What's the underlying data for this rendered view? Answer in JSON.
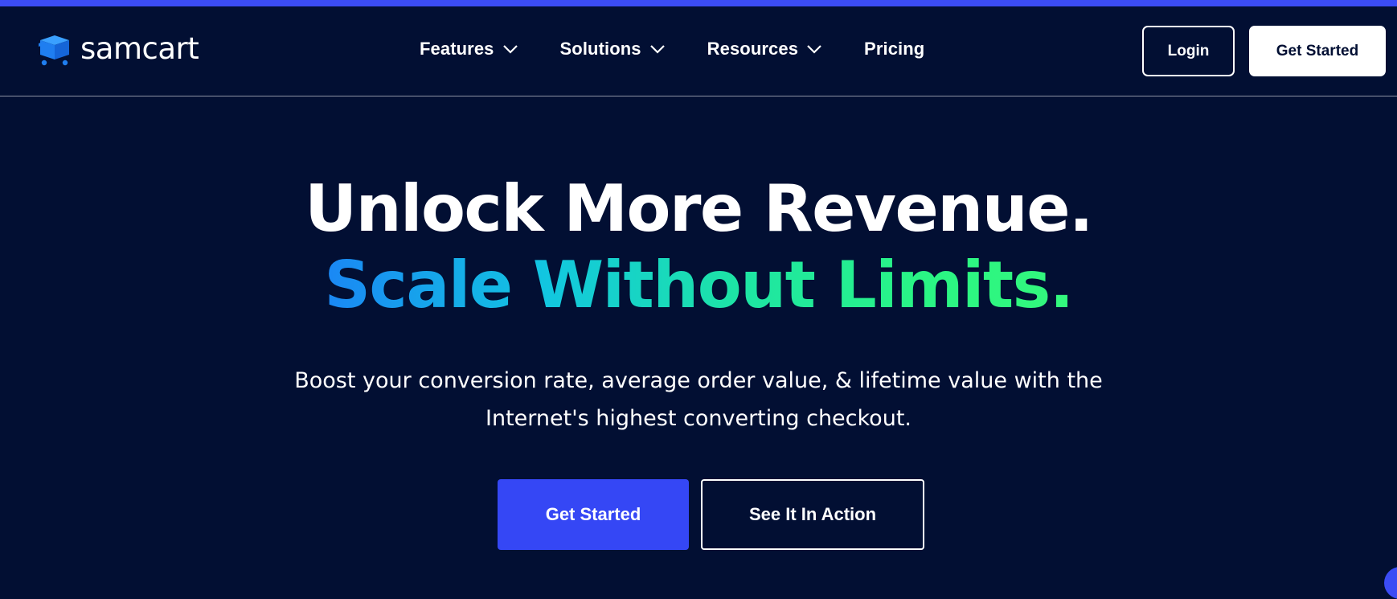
{
  "brand": {
    "name": "samcart",
    "logo_icon": "cart-box-icon",
    "accent_color": "#3547f5",
    "background_color": "#020f33"
  },
  "nav": {
    "items": [
      {
        "label": "Features",
        "has_dropdown": true
      },
      {
        "label": "Solutions",
        "has_dropdown": true
      },
      {
        "label": "Resources",
        "has_dropdown": true
      },
      {
        "label": "Pricing",
        "has_dropdown": false
      }
    ],
    "login_label": "Login",
    "get_started_label": "Get Started"
  },
  "hero": {
    "headline_line1": "Unlock More Revenue.",
    "headline_line2": "Scale Without Limits.",
    "headline_line2_gradient": [
      "#1a86f5",
      "#12c7e0",
      "#1de4a5",
      "#34f87c"
    ],
    "subtext": "Boost your conversion rate, average order value, & lifetime value with the Internet's highest converting checkout.",
    "primary_cta_label": "Get Started",
    "secondary_cta_label": "See It In Action"
  }
}
